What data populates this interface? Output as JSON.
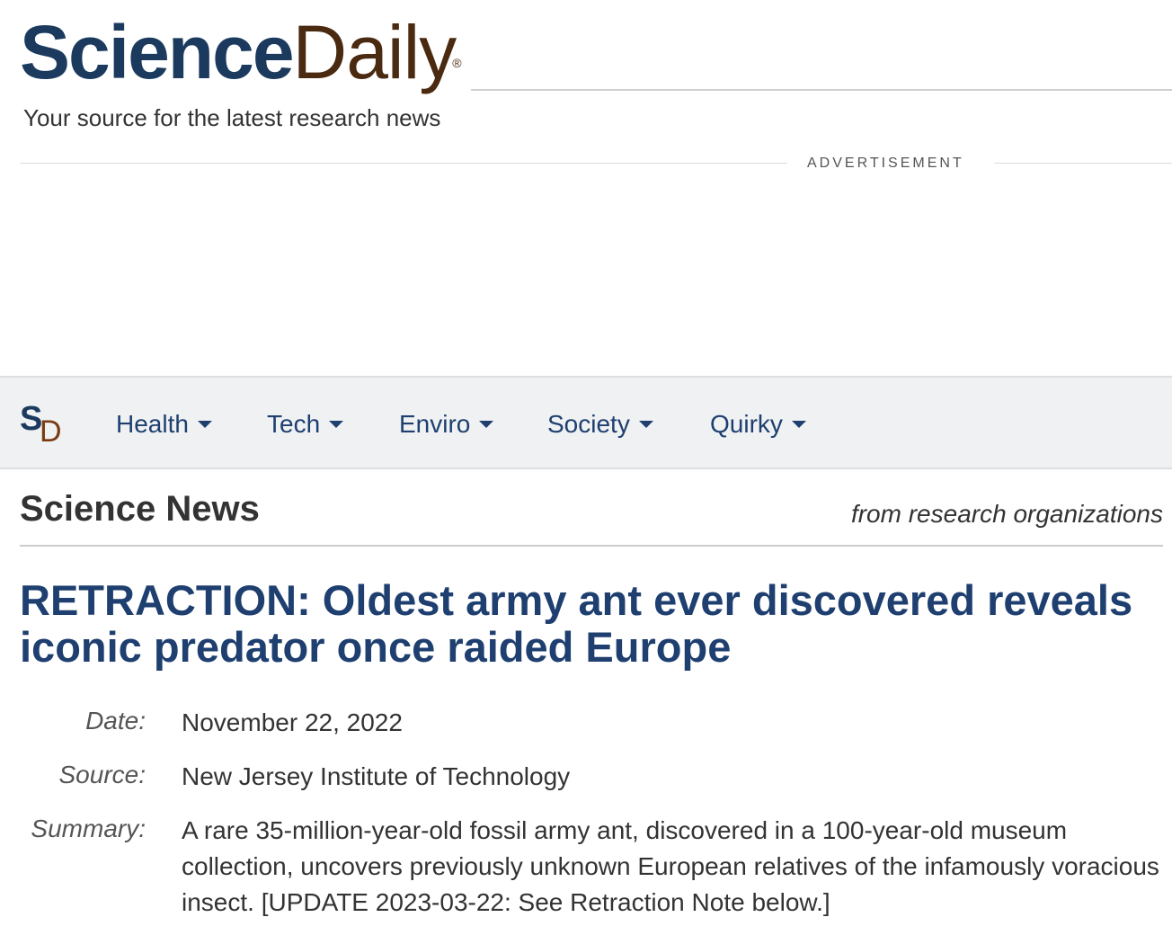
{
  "brand": {
    "name_primary": "Science",
    "name_secondary": "Daily",
    "registered": "®",
    "tagline": "Your source for the latest research news",
    "colors": {
      "primary": "#1b3a5e",
      "secondary": "#4a2a10",
      "link": "#1e3f6f"
    }
  },
  "advertisement": {
    "label": "ADVERTISEMENT"
  },
  "nav": {
    "logo_s": "S",
    "logo_d": "D",
    "items": [
      {
        "label": "Health",
        "icon": "caret-down-icon"
      },
      {
        "label": "Tech",
        "icon": "caret-down-icon"
      },
      {
        "label": "Enviro",
        "icon": "caret-down-icon"
      },
      {
        "label": "Society",
        "icon": "caret-down-icon"
      },
      {
        "label": "Quirky",
        "icon": "caret-down-icon"
      }
    ]
  },
  "section": {
    "title": "Science News",
    "subtitle": "from research organizations"
  },
  "article": {
    "headline": "RETRACTION: Oldest army ant ever discovered reveals iconic predator once raided Europe",
    "meta": {
      "date_label": "Date:",
      "date_value": "November 22, 2022",
      "source_label": "Source:",
      "source_value": "New Jersey Institute of Technology",
      "summary_label": "Summary:",
      "summary_value": "A rare 35-million-year-old fossil army ant, discovered in a 100-year-old museum collection, uncovers previously unknown European relatives of the infamously voracious insect. [UPDATE 2023-03-22: See Retraction Note below.]"
    }
  }
}
